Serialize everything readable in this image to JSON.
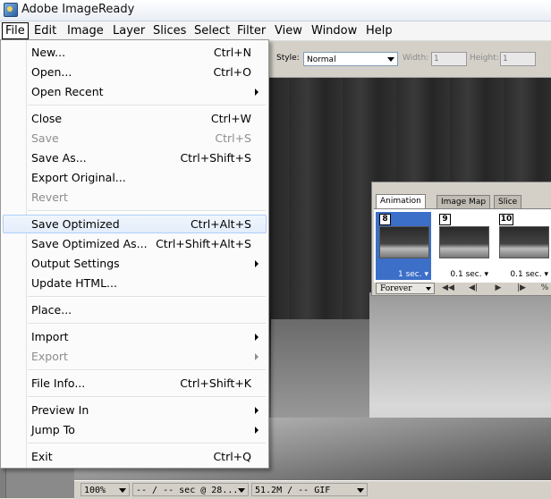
{
  "window": {
    "title": "Adobe ImageReady"
  },
  "menubar": {
    "items": [
      "File",
      "Edit",
      "Image",
      "Layer",
      "Slices",
      "Select",
      "Filter",
      "View",
      "Window",
      "Help"
    ],
    "active": "File"
  },
  "options_bar": {
    "style_label": "Style:",
    "style_value": "Normal",
    "width_label": "Width:",
    "width_value": "1",
    "height_label": "Height:",
    "height_value": "1"
  },
  "file_menu": {
    "items": [
      {
        "label": "New...",
        "shortcut": "Ctrl+N",
        "submenu": false,
        "enabled": true
      },
      {
        "label": "Open...",
        "shortcut": "Ctrl+O",
        "submenu": false,
        "enabled": true
      },
      {
        "label": "Open Recent",
        "shortcut": "",
        "submenu": true,
        "enabled": true
      },
      {
        "label": "Close",
        "shortcut": "Ctrl+W",
        "submenu": false,
        "enabled": true
      },
      {
        "label": "Save",
        "shortcut": "Ctrl+S",
        "submenu": false,
        "enabled": false
      },
      {
        "label": "Save As...",
        "shortcut": "Ctrl+Shift+S",
        "submenu": false,
        "enabled": true
      },
      {
        "label": "Export Original...",
        "shortcut": "",
        "submenu": false,
        "enabled": true
      },
      {
        "label": "Revert",
        "shortcut": "",
        "submenu": false,
        "enabled": false
      },
      {
        "label": "Save Optimized",
        "shortcut": "Ctrl+Alt+S",
        "submenu": false,
        "enabled": true,
        "highlighted": true
      },
      {
        "label": "Save Optimized As...",
        "shortcut": "Ctrl+Shift+Alt+S",
        "submenu": false,
        "enabled": true
      },
      {
        "label": "Output Settings",
        "shortcut": "",
        "submenu": true,
        "enabled": true
      },
      {
        "label": "Update HTML...",
        "shortcut": "",
        "submenu": false,
        "enabled": true
      },
      {
        "label": "Place...",
        "shortcut": "",
        "submenu": false,
        "enabled": true
      },
      {
        "label": "Import",
        "shortcut": "",
        "submenu": true,
        "enabled": true
      },
      {
        "label": "Export",
        "shortcut": "",
        "submenu": true,
        "enabled": false
      },
      {
        "label": "File Info...",
        "shortcut": "Ctrl+Shift+K",
        "submenu": false,
        "enabled": true
      },
      {
        "label": "Preview In",
        "shortcut": "",
        "submenu": true,
        "enabled": true
      },
      {
        "label": "Jump To",
        "shortcut": "",
        "submenu": true,
        "enabled": true
      },
      {
        "label": "Exit",
        "shortcut": "Ctrl+Q",
        "submenu": false,
        "enabled": true
      }
    ]
  },
  "animation_palette": {
    "tabs": [
      "Animation",
      "Image Map",
      "Slice"
    ],
    "selected_tab": "Animation",
    "frames": [
      {
        "number": "8",
        "delay": "1 sec.",
        "selected": true
      },
      {
        "number": "9",
        "delay": "0.1 sec.",
        "selected": false
      },
      {
        "number": "10",
        "delay": "0.1 sec.",
        "selected": false
      }
    ],
    "loop": "Forever"
  },
  "status_bar": {
    "zoom": "100%",
    "time": "-- / -- sec @ 28...",
    "size": "51.2M / -- GIF"
  },
  "colors": {
    "menu_highlight_border": "#aecff7",
    "selected_frame": "#3c6fc8",
    "panel_gray": "#d4d0c8"
  }
}
